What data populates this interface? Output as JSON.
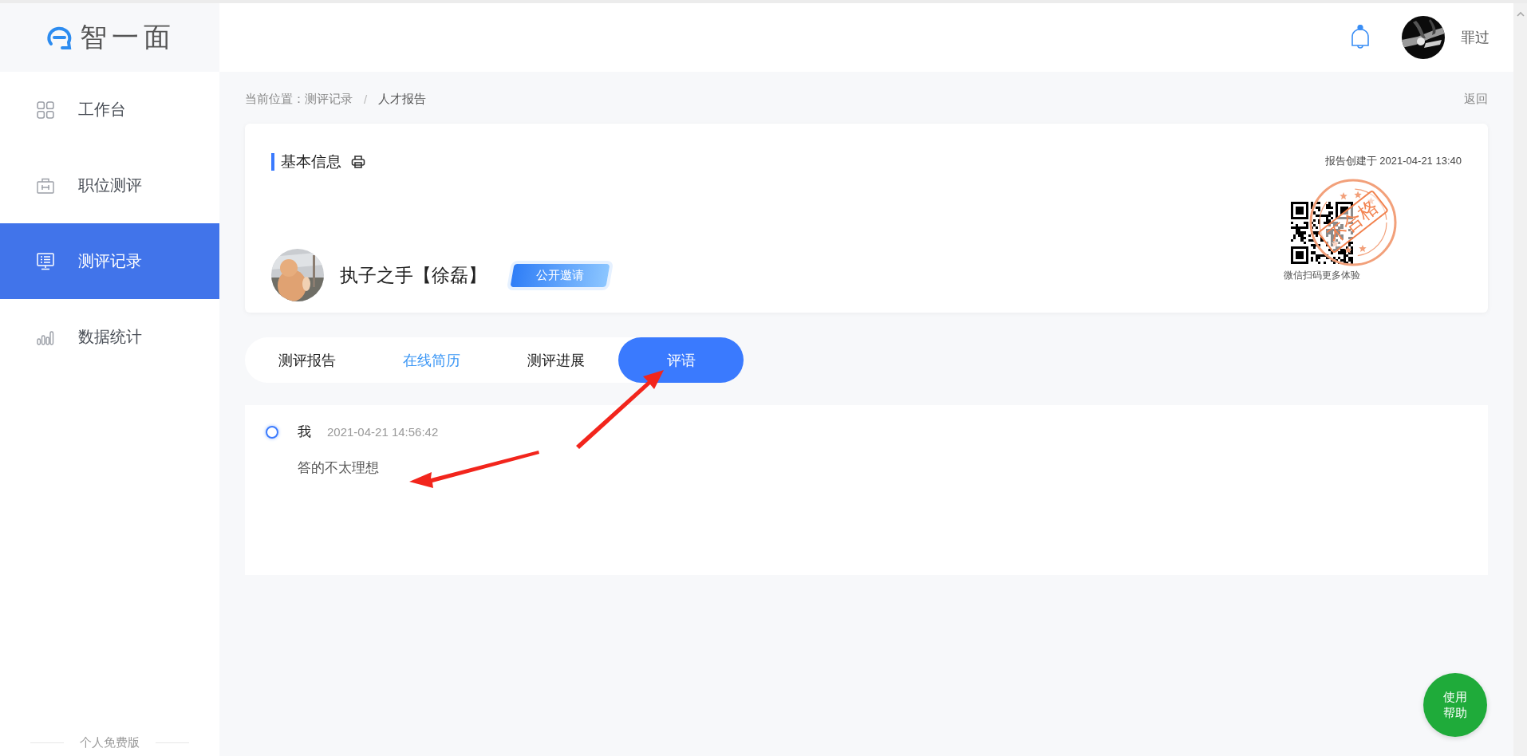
{
  "logo": {
    "text": "智一面"
  },
  "sidebar": {
    "items": [
      {
        "label": "工作台",
        "selected": false
      },
      {
        "label": "职位测评",
        "selected": false
      },
      {
        "label": "测评记录",
        "selected": true
      },
      {
        "label": "数据统计",
        "selected": false
      }
    ],
    "footer": "个人免费版"
  },
  "header": {
    "user_name": "罪过"
  },
  "breadcrumb": {
    "prefix": "当前位置：",
    "items": [
      "测评记录",
      "人才报告"
    ],
    "separator": "/",
    "back": "返回"
  },
  "basic_info": {
    "title": "基本信息",
    "created": "报告创建于 2021-04-21 13:40",
    "name": "执子之手【徐磊】",
    "badge": "公开邀请",
    "stamp": "不合格",
    "qr_caption": "微信扫码更多体验"
  },
  "tabs": [
    {
      "label": "测评报告",
      "selected": false,
      "highlighted": false
    },
    {
      "label": "在线简历",
      "selected": false,
      "highlighted": true
    },
    {
      "label": "测评进展",
      "selected": false,
      "highlighted": false
    },
    {
      "label": "评语",
      "selected": true,
      "highlighted": false
    }
  ],
  "comments": [
    {
      "author": "我",
      "time": "2021-04-21 14:56:42",
      "text": "答的不太理想"
    }
  ],
  "help_button": "使用帮助"
}
